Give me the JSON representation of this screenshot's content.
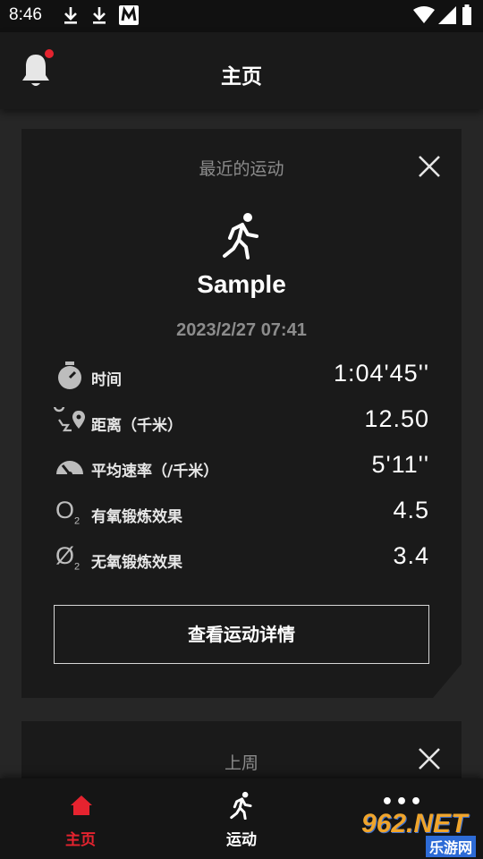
{
  "status_bar": {
    "time": "8:46",
    "icons": [
      "download-icon",
      "download-icon",
      "m-app-icon",
      "wifi-icon",
      "signal-icon",
      "battery-icon"
    ]
  },
  "header": {
    "title": "主页",
    "notification_icon": "bell-icon",
    "has_unread": true
  },
  "recent_card": {
    "title": "最近的运动",
    "activity_icon": "running-person-icon",
    "activity_name": "Sample",
    "date": "2023/2/27 07:41",
    "stats": [
      {
        "icon": "stopwatch-icon",
        "label": "时间",
        "value": "1:04'45''"
      },
      {
        "icon": "route-icon",
        "label": "距离（千米）",
        "value": "12.50"
      },
      {
        "icon": "speedometer-icon",
        "label": "平均速率（/千米）",
        "value": "5'11''"
      },
      {
        "icon": "o2-icon",
        "label": "有氧锻炼效果",
        "value": "4.5",
        "icon_text": "O",
        "icon_sub": "2"
      },
      {
        "icon": "o2-slashed-icon",
        "label": "无氧锻炼效果",
        "value": "3.4",
        "icon_text": "Ø",
        "icon_sub": "2"
      }
    ],
    "detail_button": "查看运动详情"
  },
  "week_card": {
    "title": "上周"
  },
  "tab_bar": {
    "tabs": [
      {
        "label": "主页",
        "icon": "home-icon",
        "active": true
      },
      {
        "label": "运动",
        "icon": "running-person-icon",
        "active": false
      },
      {
        "label": "",
        "icon": "more-icon",
        "dots": "•••",
        "active": false
      }
    ]
  },
  "watermark": {
    "brand": "962.NET",
    "sub": "乐游网"
  },
  "colors": {
    "accent": "#e5232f",
    "background": "#262626",
    "card": "#1a1a1a",
    "muted_text": "#8c8c8c"
  }
}
